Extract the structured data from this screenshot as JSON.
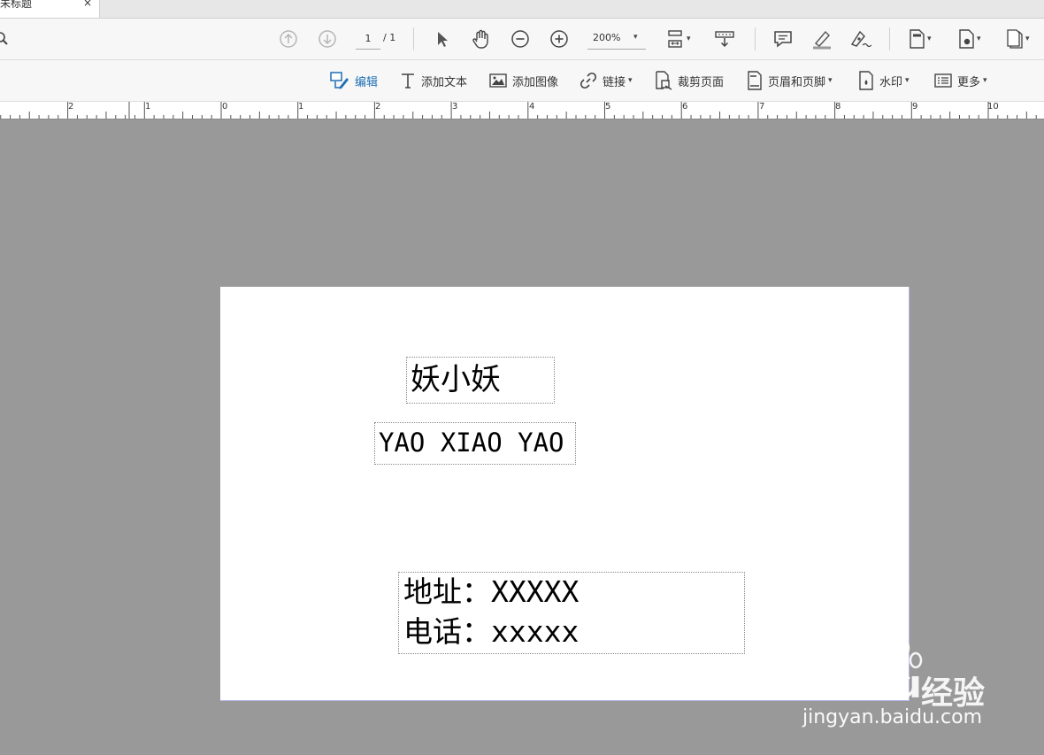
{
  "tab": {
    "title": "未标题",
    "close_label": "×"
  },
  "toolbar": {
    "page_current": "1",
    "page_total": "/ 1",
    "zoom": "200%",
    "caret": "▾"
  },
  "toolbar2": {
    "edit": "编辑",
    "add_text": "添加文本",
    "add_image": "添加图像",
    "link": "链接",
    "crop": "裁剪页面",
    "header_footer": "页眉和页脚",
    "watermark": "水印",
    "more": "更多"
  },
  "ruler": {
    "labels": [
      "2",
      "1",
      "0",
      "1",
      "2",
      "3",
      "4",
      "5",
      "6",
      "7",
      "8",
      "9",
      "10"
    ]
  },
  "document": {
    "name_cn": "妖小妖",
    "name_pinyin": "YAO XIAO YAO",
    "address": "地址：XXXXX",
    "phone": "电话：xxxxx"
  },
  "watermark": {
    "logo": "Baidu",
    "jingyan": "经验",
    "url": "jingyan.baidu.com"
  },
  "colors": {
    "accent": "#1f6fb5",
    "canvas_bg": "#999999",
    "page_bg": "#ffffff"
  }
}
